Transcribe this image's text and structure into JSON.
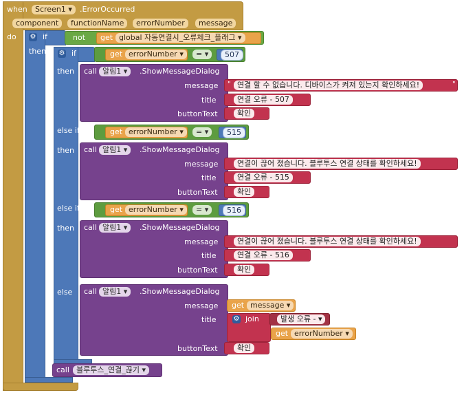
{
  "event": {
    "when": "when",
    "component": "Screen1",
    "event_name": ".ErrorOccurred",
    "params": [
      "component",
      "functionName",
      "errorNumber",
      "message"
    ],
    "do": "do"
  },
  "outer_if": {
    "if": "if",
    "not": "not",
    "get": "get",
    "global_var": "global 자동연결시_오류체크_플래그",
    "then": "then"
  },
  "inner_if": {
    "if": "if",
    "then": "then",
    "else_if": "else if",
    "else": "else",
    "get": "get",
    "error_number": "errorNumber",
    "eq": "=",
    "values": [
      "507",
      "515",
      "516"
    ]
  },
  "call": {
    "call": "call",
    "component": "알림1",
    "method": ".ShowMessageDialog",
    "message_label": "message",
    "title_label": "title",
    "button_label": "buttonText"
  },
  "dialogs": [
    {
      "message": "연결 할 수 없습니다. 디바이스가 켜져 있는지 확인하세요!",
      "title": "연결 오류 - 507",
      "button": "확인"
    },
    {
      "message": "연결이 끊어 졌습니다. 블루투스 연결 상태를 확인하세요!",
      "title": "연결 오류 - 515",
      "button": "확인"
    },
    {
      "message": "연결이 끊어 졌습니다. 블루투스 연결 상태를 확인하세요!",
      "title": "연결 오류 - 516",
      "button": "확인"
    }
  ],
  "else_dialog": {
    "get": "get",
    "message_var": "message",
    "join": "join",
    "prefix": "발생 오류 -",
    "get2": "get",
    "error_var": "errorNumber",
    "button": "확인"
  },
  "final_call": {
    "call": "call",
    "procedure": "블루투스_연결_끊기"
  }
}
